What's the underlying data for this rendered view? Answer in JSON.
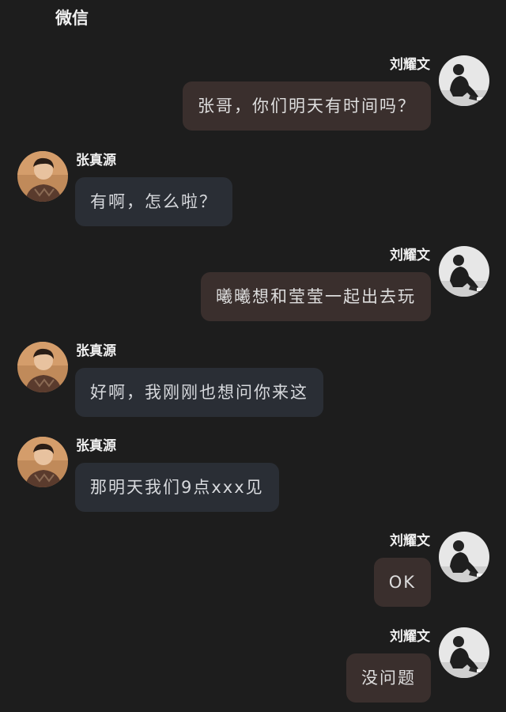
{
  "app": {
    "title": "微信"
  },
  "colors": {
    "background": "#1d1d1d",
    "bubble_self": "#3a2f2d",
    "bubble_other": "#2a2e35"
  },
  "messages": [
    {
      "side": "right",
      "sender": "刘耀文",
      "text": "张哥，你们明天有时间吗？"
    },
    {
      "side": "left",
      "sender": "张真源",
      "text": "有啊，怎么啦？"
    },
    {
      "side": "right",
      "sender": "刘耀文",
      "text": "曦曦想和莹莹一起出去玩"
    },
    {
      "side": "left",
      "sender": "张真源",
      "text": "好啊，我刚刚也想问你来这"
    },
    {
      "side": "left",
      "sender": "张真源",
      "text": "那明天我们9点xxx见"
    },
    {
      "side": "right",
      "sender": "刘耀文",
      "text": "OK"
    },
    {
      "side": "right",
      "sender": "刘耀文",
      "text": "没问题"
    }
  ]
}
